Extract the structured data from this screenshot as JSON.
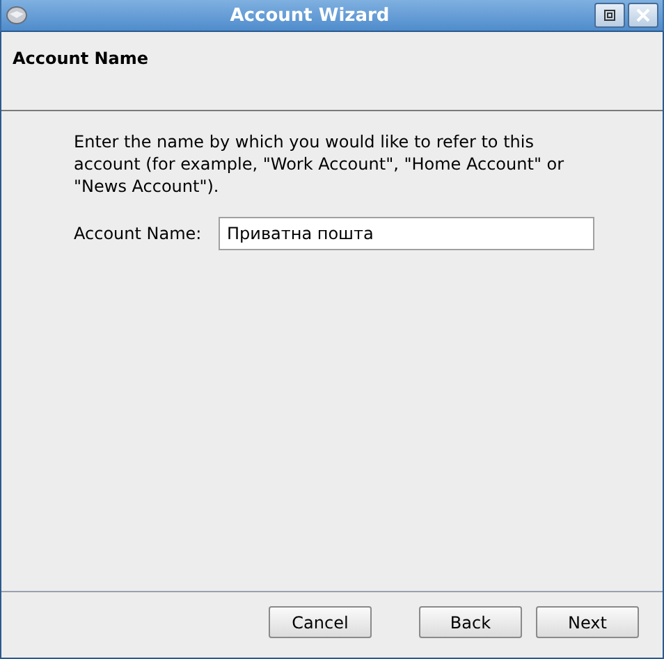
{
  "window": {
    "title": "Account Wizard"
  },
  "page": {
    "heading": "Account Name",
    "description": "Enter the name by which you would like to refer to this account (for example, \"Work Account\", \"Home Account\" or \"News Account\").",
    "field": {
      "label": "Account Name:",
      "value": "Приватна пошта"
    }
  },
  "buttons": [
    {
      "label": "Cancel"
    },
    {
      "label": "Back"
    },
    {
      "label": "Next"
    }
  ]
}
